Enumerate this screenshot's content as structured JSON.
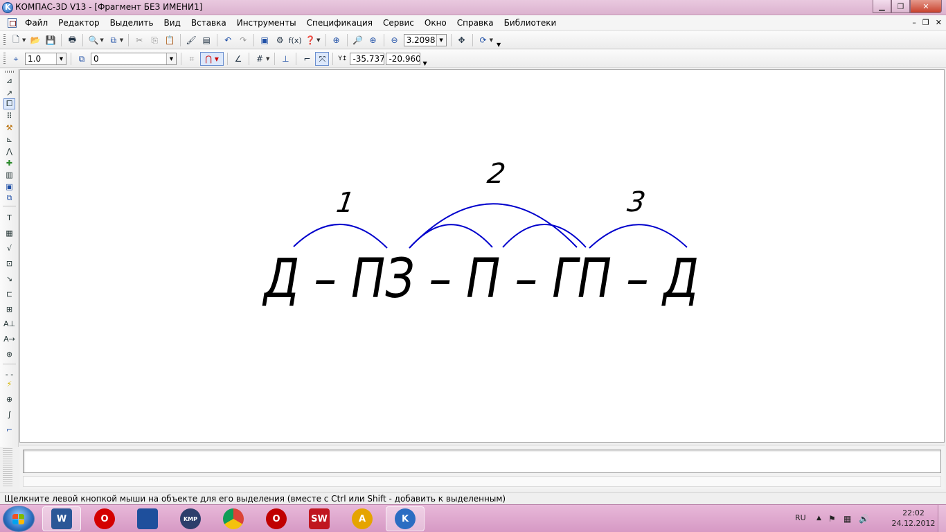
{
  "window": {
    "title": "КОМПАС-3D V13 - [Фрагмент БЕЗ ИМЕНИ1]",
    "min_glyph": "▁",
    "max_glyph": "❐",
    "close_glyph": "✕"
  },
  "menu": {
    "items": [
      "Файл",
      "Редактор",
      "Выделить",
      "Вид",
      "Вставка",
      "Инструменты",
      "Спецификация",
      "Сервис",
      "Окно",
      "Справка",
      "Библиотеки"
    ],
    "mdi_min": "–",
    "mdi_restore": "❐",
    "mdi_close": "✕"
  },
  "toolbar": {
    "zoom_value": "3.2098"
  },
  "props_toolbar": {
    "step_value": "1.0",
    "layer_value": "0",
    "coord_label": "Y↕",
    "x_coord": "-35.737",
    "y_coord": "-20.960"
  },
  "drawing": {
    "formula": "Д – ПЗ – П – ГП – Д",
    "arc_labels": [
      "1",
      "2",
      "3"
    ],
    "stroke_color": "#0000cc"
  },
  "status": {
    "hint": "Щелкните левой кнопкой мыши на объекте для его выделения (вместе с Ctrl или Shift - добавить к выделенным)"
  },
  "taskbar": {
    "apps": [
      {
        "name": "word",
        "label": "W",
        "color": "#2b5797"
      },
      {
        "name": "opera",
        "label": "O",
        "color": "#d40000"
      },
      {
        "name": "save",
        "label": "",
        "color": "#1e4f9c"
      },
      {
        "name": "kmplayer",
        "label": "KMP",
        "color": "#2c3e6b"
      },
      {
        "name": "chrome",
        "label": "",
        "color": "#e0a800"
      },
      {
        "name": "opera-2",
        "label": "O",
        "color": "#c00000"
      },
      {
        "name": "solidworks",
        "label": "SW",
        "color": "#c0161f"
      },
      {
        "name": "archicad",
        "label": "A",
        "color": "#e5a400"
      },
      {
        "name": "kompas",
        "label": "K",
        "color": "#2b6dc2"
      }
    ],
    "tray": {
      "lang": "RU",
      "time": "22:02",
      "date": "24.12.2012"
    }
  }
}
